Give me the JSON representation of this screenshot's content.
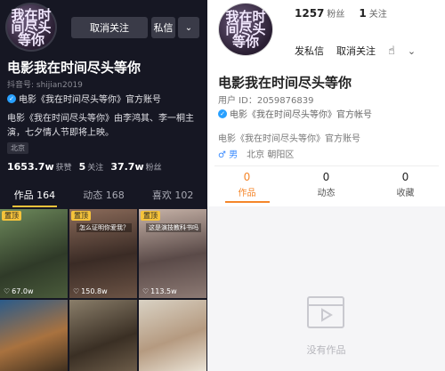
{
  "left": {
    "avatar_text": "我在时间尽头等你",
    "unfollow_label": "取消关注",
    "message_label": "私信",
    "name": "电影我在时间尽头等你",
    "douyin_id": "抖音号: shijian2019",
    "official": "电影《我在时间尽头等你》官方账号",
    "bio": "电影《我在时间尽头等你》由李鸿其、李一桐主演，七夕情人节即将上映。",
    "location": "北京",
    "stats": [
      {
        "value": "1653.7w",
        "label": "获赞"
      },
      {
        "value": "5",
        "label": "关注"
      },
      {
        "value": "37.7w",
        "label": "粉丝"
      }
    ],
    "tabs": [
      {
        "label": "作品 164"
      },
      {
        "label": "动态 168"
      },
      {
        "label": "喜欢 102"
      }
    ],
    "videos": [
      {
        "pin": "置顶",
        "likes": "67.0w",
        "caption": ""
      },
      {
        "pin": "置顶",
        "likes": "150.8w",
        "caption": "怎么证明你爱我？"
      },
      {
        "pin": "置顶",
        "likes": "113.5w",
        "caption": "这是演技教科书吗"
      },
      {
        "pin": "",
        "likes": "",
        "caption": ""
      },
      {
        "pin": "",
        "likes": "",
        "caption": ""
      },
      {
        "pin": "",
        "likes": "",
        "caption": ""
      }
    ],
    "colors": {
      "bg": "#161723",
      "accent": "#f5c33b"
    }
  },
  "right": {
    "avatar_text": "我在时间尽头等你",
    "fans_count": "1257",
    "fans_label": "粉丝",
    "following_count": "1",
    "following_label": "关注",
    "message_label": "发私信",
    "unfollow_label": "取消关注",
    "name": "电影我在时间尽头等你",
    "user_id": "用户 ID：2059876839",
    "official": "电影《我在时间尽头等你》官方帐号",
    "bio": "电影《我在时间尽头等你》官方账号",
    "gender": "♂ 男",
    "region": "北京 朝阳区",
    "tabs": [
      {
        "count": "0",
        "label": "作品"
      },
      {
        "count": "0",
        "label": "动态"
      },
      {
        "count": "0",
        "label": "收藏"
      }
    ],
    "empty_text": "没有作品",
    "colors": {
      "accent": "#f5862a"
    }
  }
}
